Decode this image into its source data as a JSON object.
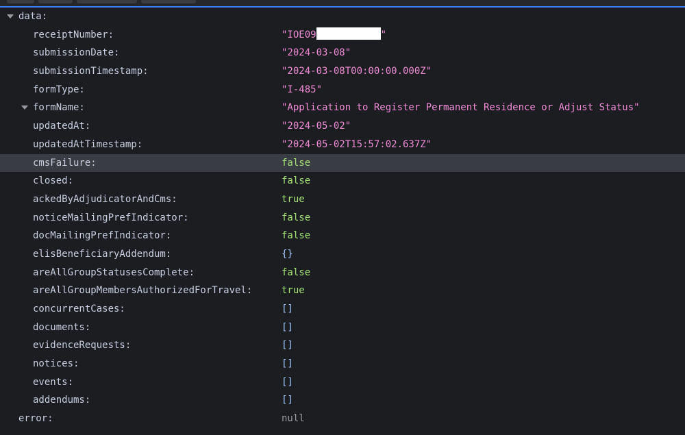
{
  "root": {
    "data_key": "data:",
    "error_key": "error:",
    "error_value": "null"
  },
  "receipt": {
    "prefix": "\"IOE09",
    "suffix": "\""
  },
  "rows": [
    {
      "key": "receiptNumber:",
      "value": "",
      "kind": "redacted"
    },
    {
      "key": "submissionDate:",
      "value": "\"2024-03-08\"",
      "kind": "str"
    },
    {
      "key": "submissionTimestamp:",
      "value": "\"2024-03-08T00:00:00.000Z\"",
      "kind": "str"
    },
    {
      "key": "formType:",
      "value": "\"I-485\"",
      "kind": "str"
    },
    {
      "key": "formName:",
      "value": "\"Application to Register Permanent Residence or Adjust Status\"",
      "kind": "str"
    },
    {
      "key": "updatedAt:",
      "value": "\"2024-05-02\"",
      "kind": "str"
    },
    {
      "key": "updatedAtTimestamp:",
      "value": "\"2024-05-02T15:57:02.637Z\"",
      "kind": "str"
    },
    {
      "key": "cmsFailure:",
      "value": "false",
      "kind": "bool"
    },
    {
      "key": "closed:",
      "value": "false",
      "kind": "bool"
    },
    {
      "key": "ackedByAdjudicatorAndCms:",
      "value": "true",
      "kind": "bool"
    },
    {
      "key": "noticeMailingPrefIndicator:",
      "value": "false",
      "kind": "bool"
    },
    {
      "key": "docMailingPrefIndicator:",
      "value": "false",
      "kind": "bool"
    },
    {
      "key": "elisBeneficiaryAddendum:",
      "value": "{}",
      "kind": "obj"
    },
    {
      "key": "areAllGroupStatusesComplete:",
      "value": "false",
      "kind": "bool"
    },
    {
      "key": "areAllGroupMembersAuthorizedForTravel:",
      "value": "true",
      "kind": "bool"
    },
    {
      "key": "concurrentCases:",
      "value": "[]",
      "kind": "obj"
    },
    {
      "key": "documents:",
      "value": "[]",
      "kind": "obj"
    },
    {
      "key": "evidenceRequests:",
      "value": "[]",
      "kind": "obj"
    },
    {
      "key": "notices:",
      "value": "[]",
      "kind": "obj"
    },
    {
      "key": "events:",
      "value": "[]",
      "kind": "obj"
    },
    {
      "key": "addendums:",
      "value": "[]",
      "kind": "obj"
    }
  ],
  "colors": {
    "string": "#f08cd6",
    "boolean": "#a5e075",
    "object": "#a7c7ff",
    "null": "#9a9ca4",
    "selection": "#3a3c44",
    "accent": "#3d7df0"
  },
  "icons": {
    "expand": "triangle-down-icon"
  }
}
